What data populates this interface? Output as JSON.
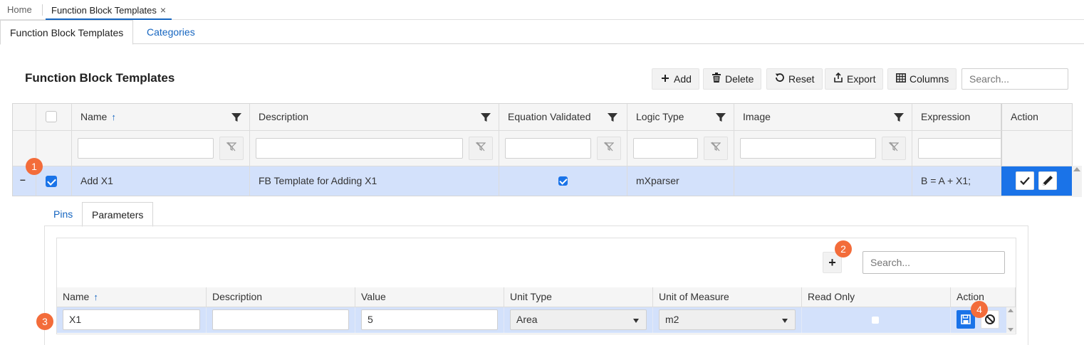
{
  "doc_tabs": {
    "home": "Home",
    "active": "Function Block Templates",
    "close": "×"
  },
  "page_tabs": [
    {
      "label": "Function Block Templates"
    },
    {
      "label": "Categories"
    }
  ],
  "main": {
    "title": "Function Block Templates",
    "toolbar": {
      "add": "Add",
      "delete": "Delete",
      "reset": "Reset",
      "export": "Export",
      "columns": "Columns"
    },
    "search_placeholder": "Search..."
  },
  "grid": {
    "columns": {
      "name": "Name",
      "description": "Description",
      "equation_validated": "Equation Validated",
      "logic_type": "Logic Type",
      "image": "Image",
      "expression": "Expression",
      "action": "Action"
    },
    "sort_indicator": "↑",
    "row": {
      "collapse": "–",
      "selected": true,
      "name": "Add X1",
      "description": "FB Template for Adding X1",
      "equation_validated": true,
      "logic_type": "mXparser",
      "image": "",
      "expression": "B = A + X1;"
    }
  },
  "detail": {
    "tabs": [
      {
        "label": "Pins"
      },
      {
        "label": "Parameters"
      }
    ],
    "add_label": "+",
    "search_placeholder": "Search...",
    "columns": {
      "name": "Name",
      "description": "Description",
      "value": "Value",
      "unit_type": "Unit Type",
      "unit_of_measure": "Unit of Measure",
      "read_only": "Read Only",
      "action": "Action"
    },
    "row": {
      "name": "X1",
      "description": "",
      "value": "5",
      "unit_type": "Area",
      "unit_of_measure": "m2",
      "read_only": false
    }
  },
  "badges": [
    "1",
    "2",
    "3",
    "4"
  ],
  "colors": {
    "accent": "#1a73e8",
    "selected_row": "#d3e1fb",
    "badge": "#f36c3a",
    "link": "#1565c0"
  }
}
